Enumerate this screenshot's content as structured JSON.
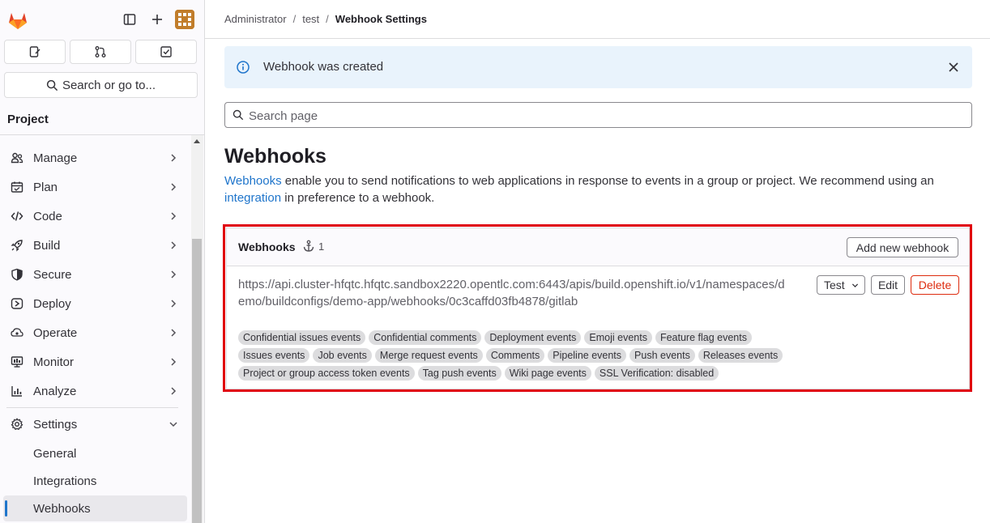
{
  "breadcrumb": [
    "Administrator",
    "test",
    "Webhook Settings"
  ],
  "sidebar": {
    "search_label": "Search or go to...",
    "section_title": "Project",
    "items": [
      {
        "label": "Manage",
        "icon": "users-icon"
      },
      {
        "label": "Plan",
        "icon": "calendar-icon"
      },
      {
        "label": "Code",
        "icon": "code-icon"
      },
      {
        "label": "Build",
        "icon": "rocket-icon"
      },
      {
        "label": "Secure",
        "icon": "shield-icon"
      },
      {
        "label": "Deploy",
        "icon": "deploy-icon"
      },
      {
        "label": "Operate",
        "icon": "cloud-gear-icon"
      },
      {
        "label": "Monitor",
        "icon": "monitor-icon"
      },
      {
        "label": "Analyze",
        "icon": "chart-icon"
      },
      {
        "label": "Settings",
        "icon": "gear-icon"
      }
    ],
    "settings_sub": [
      "General",
      "Integrations",
      "Webhooks"
    ]
  },
  "alert": {
    "message": "Webhook was created"
  },
  "page_search": {
    "placeholder": "Search page"
  },
  "page": {
    "title": "Webhooks",
    "desc_link1": "Webhooks",
    "desc_text1": " enable you to send notifications to web applications in response to events in a group or project. We recommend using an ",
    "desc_link2": "integration",
    "desc_text2": " in preference to a webhook."
  },
  "card": {
    "title": "Webhooks",
    "count": "1",
    "add_button": "Add new webhook"
  },
  "hook": {
    "url": "https://api.cluster-hfqtc.hfqtc.sandbox2220.opentlc.com:6443/apis/build.openshift.io/v1/namespaces/demo/buildconfigs/demo-app/webhooks/0c3caffd03fb4878/gitlab",
    "test_label": "Test",
    "edit_label": "Edit",
    "delete_label": "Delete",
    "badge_rows": [
      [
        "Confidential issues events",
        "Confidential comments",
        "Deployment events",
        "Emoji events",
        "Feature flag events"
      ],
      [
        "Issues events",
        "Job events",
        "Merge request events",
        "Comments",
        "Pipeline events",
        "Push events",
        "Releases events"
      ],
      [
        "Project or group access token events",
        "Tag push events",
        "Wiki page events",
        "SSL Verification: disabled"
      ]
    ]
  },
  "colors": {
    "accent": "#1f75cb",
    "danger": "#dd2b0e",
    "highlight": "#e0000e",
    "info_bg": "#e9f3fc"
  }
}
